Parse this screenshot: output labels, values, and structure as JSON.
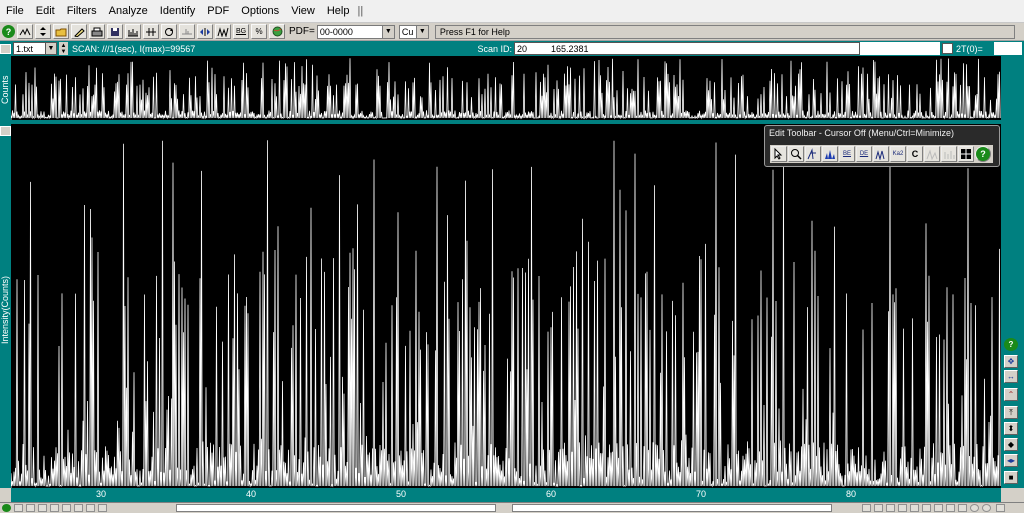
{
  "menu": {
    "items": [
      "File",
      "Edit",
      "Filters",
      "Analyze",
      "Identify",
      "PDF",
      "Options",
      "View",
      "Help"
    ],
    "separator": "||"
  },
  "toolbar": {
    "pdf_label": "PDF=",
    "pdf_value": "00-0000",
    "anode_value": "Cu",
    "status_message": "Press F1 for Help",
    "help_glyph": "?"
  },
  "scanbar": {
    "file_value": "1.txt",
    "scan_info": "SCAN: ///1(sec), I(max)=99567",
    "scan_id_label": "Scan ID:",
    "scan_id_start": "20",
    "scan_id_end": "165.2381",
    "two_theta_label": "2T(0)="
  },
  "plot": {
    "top_ylabel": "Counts",
    "main_ylabel": "Intensity(Counts)",
    "x_range": [
      24,
      90
    ],
    "x_ticks": [
      30,
      40,
      50,
      60,
      70,
      80
    ],
    "intensity_max": 99567,
    "trace_color": "#ffffff",
    "background_color": "#000000"
  },
  "edit_toolbar": {
    "title": "Edit Toolbar - Cursor Off (Menu/Ctrl=Minimize)",
    "tools": [
      "select-icon",
      "zoom-icon",
      "peak-icon",
      "profile-icon",
      "bg-icon",
      "bg-edit-icon",
      "smooth-icon",
      "kalpha-icon",
      "cursor-icon",
      "tool-a-icon",
      "tool-b-icon",
      "grid-icon",
      "help-icon"
    ]
  },
  "colors": {
    "teal": "#008080",
    "window_gray": "#d4d0c8",
    "help_green": "#1a8a1a"
  }
}
